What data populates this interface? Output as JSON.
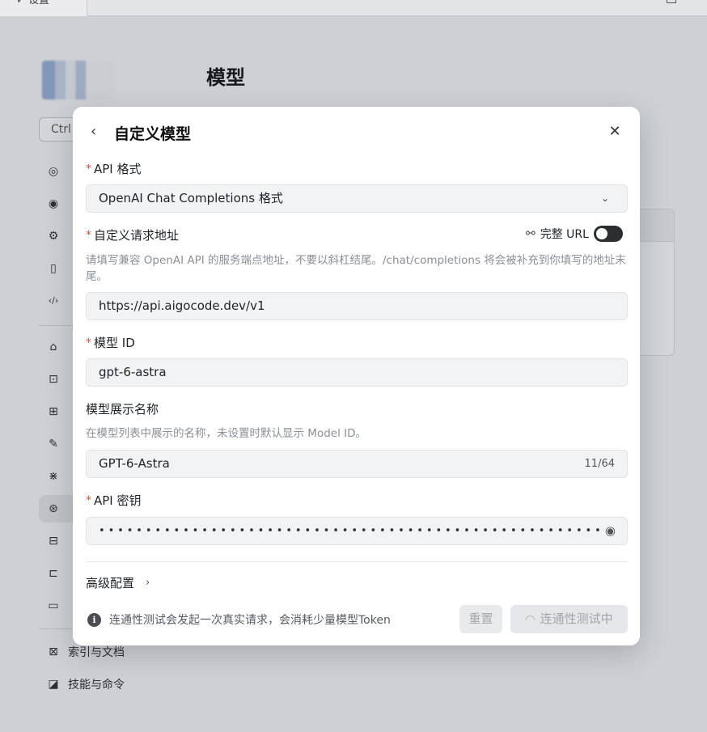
{
  "topbar": {
    "tab_label": "✓ 设置"
  },
  "page": {
    "title": "模型",
    "search_hint": "Ctrl"
  },
  "sidebar": {
    "items": [
      {
        "icon": "user-circle-icon",
        "glyph": "◎"
      },
      {
        "icon": "palette-icon",
        "glyph": "◉"
      },
      {
        "icon": "settings-icon",
        "glyph": "⚙"
      },
      {
        "icon": "phone-icon",
        "glyph": "▯"
      },
      {
        "icon": "code-icon",
        "glyph": "‹/›"
      },
      {
        "icon": "lock-icon",
        "glyph": "⌂"
      },
      {
        "icon": "chat-icon",
        "glyph": "⊡"
      },
      {
        "icon": "apps-icon",
        "glyph": "⊞"
      },
      {
        "icon": "wrench-icon",
        "glyph": "✎"
      },
      {
        "icon": "sparkle-icon",
        "glyph": "⋇"
      },
      {
        "icon": "model-icon",
        "glyph": "⊛",
        "active": true
      },
      {
        "icon": "terminal-icon",
        "glyph": "⊟"
      },
      {
        "icon": "select-icon",
        "glyph": "⊏"
      },
      {
        "icon": "monitor-icon",
        "glyph": "▭"
      }
    ],
    "bottom": [
      {
        "icon": "index-docs-icon",
        "glyph": "⊠",
        "label": "索引与文档"
      },
      {
        "icon": "skills-icon",
        "glyph": "◪",
        "label": "技能与命令"
      }
    ]
  },
  "modal": {
    "title": "自定义模型",
    "api_format": {
      "label": "API 格式",
      "value": "OpenAI Chat Completions 格式"
    },
    "endpoint": {
      "label": "自定义请求地址",
      "full_url_label": "完整 URL",
      "full_url_enabled": true,
      "help": "请填写兼容 OpenAI API 的服务端点地址，不要以斜杠结尾。/chat/completions 将会被补充到你填写的地址末尾。",
      "value": "https://api.aigocode.dev/v1"
    },
    "model_id": {
      "label": "模型 ID",
      "value": "gpt-6-astra"
    },
    "display_name": {
      "label": "模型展示名称",
      "help": "在模型列表中展示的名称，未设置时默认显示 Model ID。",
      "value": "GPT-6-Astra",
      "counter": "11/64"
    },
    "api_key": {
      "label": "API 密钥",
      "masked": "••••••••••••••••••••••••••••••••••••••••••••••••••••••••••••••"
    },
    "advanced_label": "高级配置",
    "info_text": "连通性测试会发起一次真实请求，会消耗少量模型Token",
    "reset_label": "重置",
    "test_label": "连通性测试中"
  }
}
